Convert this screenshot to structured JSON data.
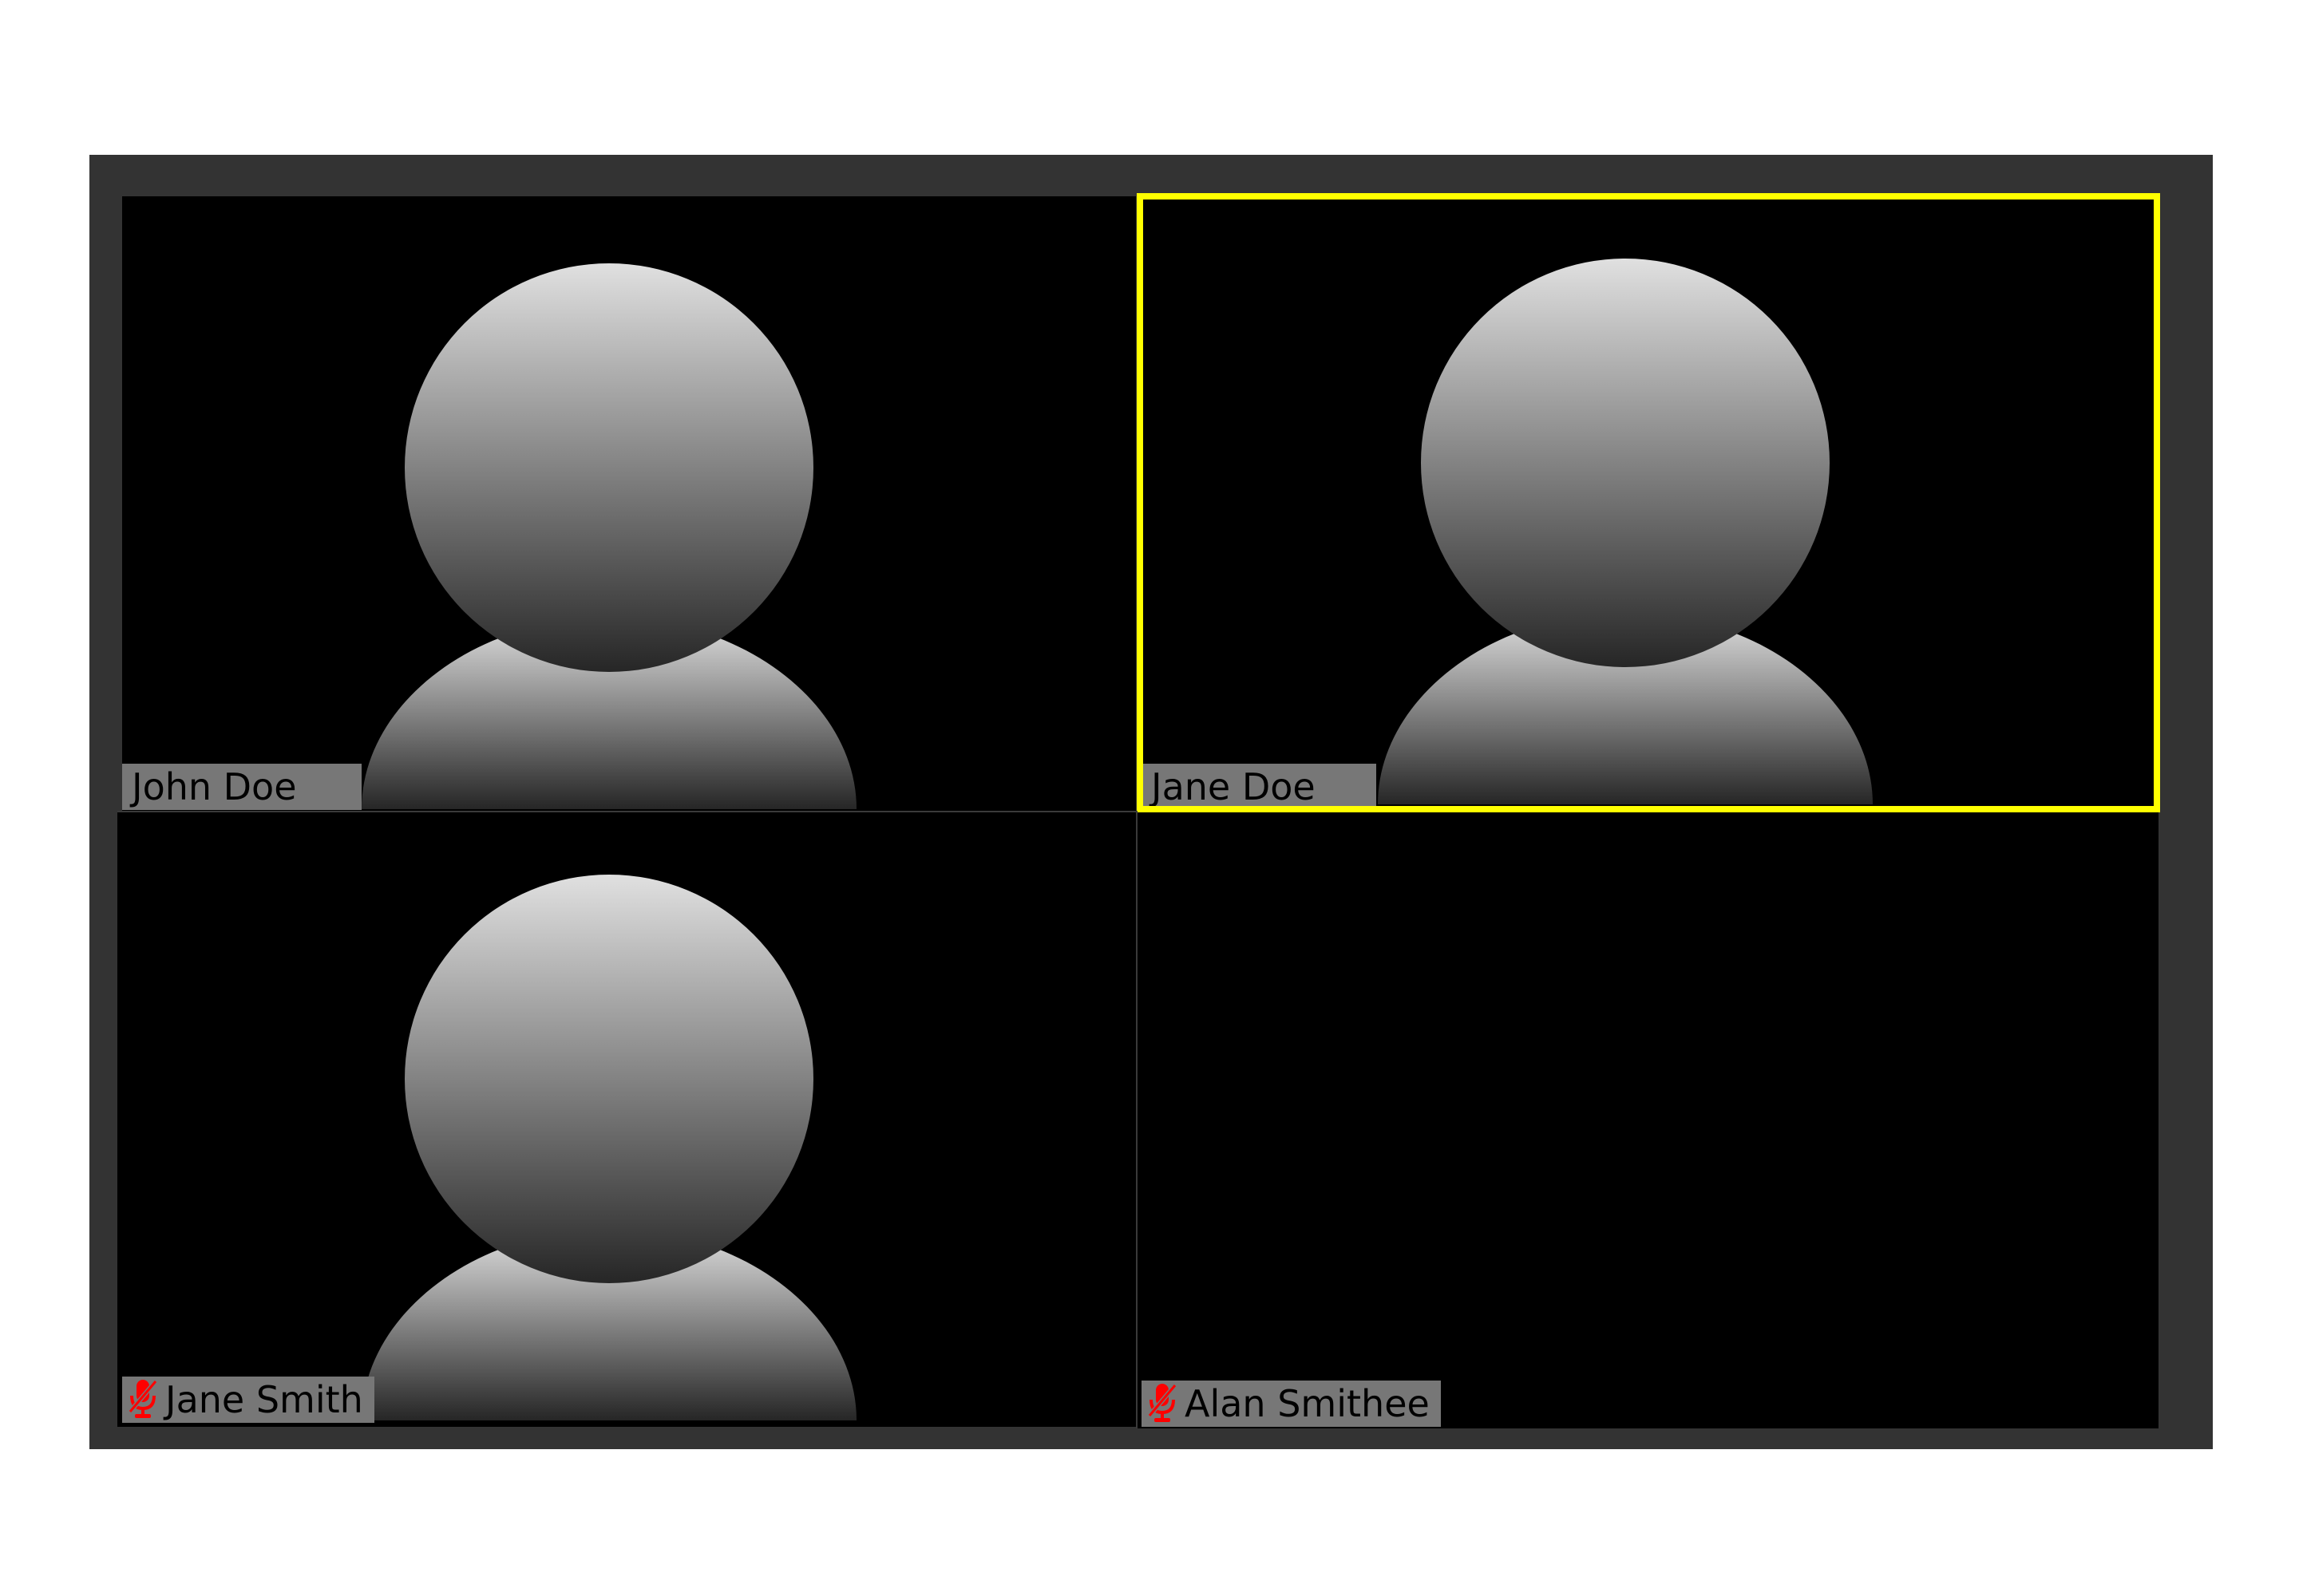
{
  "participants": [
    {
      "name": "John Doe",
      "muted": false,
      "video": true,
      "active_speaker": false
    },
    {
      "name": "Jane Doe",
      "muted": false,
      "video": true,
      "active_speaker": true
    },
    {
      "name": "Jane Smith",
      "muted": true,
      "video": true,
      "active_speaker": false
    },
    {
      "name": "Alan Smithee",
      "muted": true,
      "video": false,
      "active_speaker": false
    }
  ],
  "icons": {
    "avatar": "person-silhouette-icon",
    "muted": "mic-muted-icon"
  },
  "colors": {
    "frame": "#333333",
    "tile_background": "#000000",
    "active_speaker_border": "#ffff00",
    "name_tag_background": "#777777",
    "muted_icon": "#ff0000"
  }
}
